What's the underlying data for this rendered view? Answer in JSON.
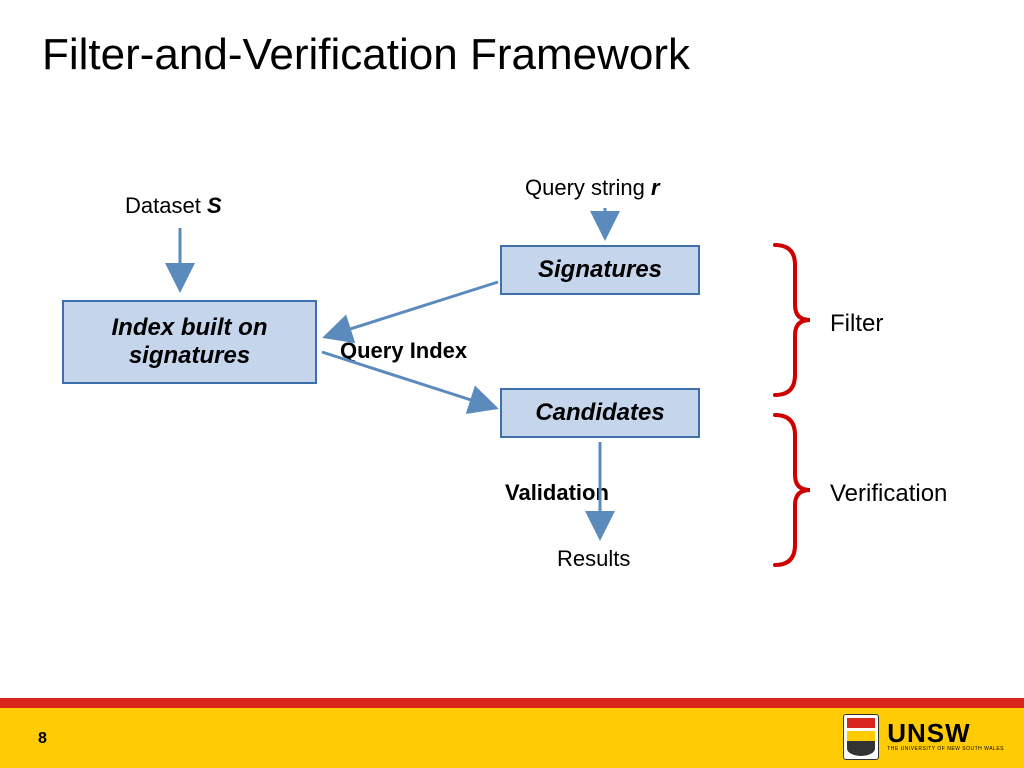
{
  "title": "Filter-and-Verification Framework",
  "labels": {
    "dataset_prefix": "Dataset ",
    "dataset_var": "S",
    "query_prefix": "Query string ",
    "query_var": "r",
    "query_index": "Query Index",
    "validation": "Validation",
    "results": "Results"
  },
  "boxes": {
    "index": "Index built on signatures",
    "signatures": "Signatures",
    "candidates": "Candidates"
  },
  "phases": {
    "filter": "Filter",
    "verification": "Verification"
  },
  "page": "8",
  "logo": {
    "name": "UNSW",
    "sub": "THE UNIVERSITY OF NEW SOUTH WALES"
  }
}
